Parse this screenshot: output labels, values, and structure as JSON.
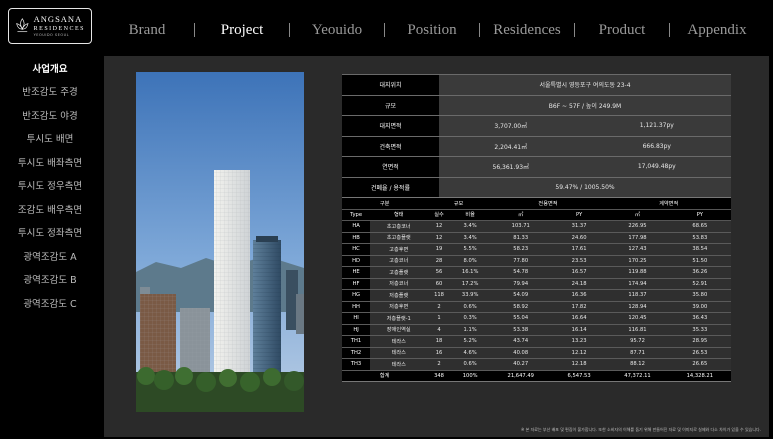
{
  "logo": {
    "main": "ANGSANA",
    "sub": "RESIDENCES",
    "tag": "YEOUIDO SEOUL"
  },
  "nav": {
    "items": [
      "Brand",
      "Project",
      "Yeouido",
      "Position",
      "Residences",
      "Product",
      "Appendix"
    ],
    "active": "Project"
  },
  "sidebar": {
    "items": [
      "사업개요",
      "반조감도 주경",
      "반조감도 야경",
      "투시도 배면",
      "투시도 배좌측면",
      "투시도 정우측면",
      "조감도 배우측면",
      "투시도 정좌측면",
      "광역조감도 A",
      "광역조감도 B",
      "광역조감도 C"
    ],
    "active": "사업개요"
  },
  "info": {
    "rows": [
      {
        "label": "대지위치",
        "values": [
          "서울특별시 영등포구 여의도동 23-4"
        ]
      },
      {
        "label": "규모",
        "values": [
          "B6F ~ 57F / 높이 249.9M"
        ]
      },
      {
        "label": "대지면적",
        "values": [
          "3,707.00㎡",
          "1,121.37py"
        ]
      },
      {
        "label": "건축면적",
        "values": [
          "2,204.41㎡",
          "666.83py"
        ]
      },
      {
        "label": "연면적",
        "values": [
          "56,361.93㎡",
          "17,049.48py"
        ]
      },
      {
        "label": "건폐율 / 용적률",
        "values": [
          "59.47% / 1005.50%"
        ]
      }
    ]
  },
  "units": {
    "header1": [
      "구분",
      "규모",
      "전용면적",
      "계약면적"
    ],
    "header2": [
      "Type",
      "형태",
      "실수",
      "비율",
      "㎡",
      "PY",
      "㎡",
      "PY"
    ],
    "rows": [
      [
        "HA",
        "초고층코너",
        "12",
        "3.4%",
        "103.71",
        "31.37",
        "226.95",
        "68.65"
      ],
      [
        "HB",
        "초고층플랫",
        "12",
        "3.4%",
        "81.33",
        "24.60",
        "177.98",
        "53.83"
      ],
      [
        "HC",
        "고층후면",
        "19",
        "5.5%",
        "58.23",
        "17.61",
        "127.43",
        "38.54"
      ],
      [
        "HD",
        "고층코너",
        "28",
        "8.0%",
        "77.80",
        "23.53",
        "170.25",
        "51.50"
      ],
      [
        "HE",
        "고층플랫",
        "56",
        "16.1%",
        "54.78",
        "16.57",
        "119.88",
        "36.26"
      ],
      [
        "HF",
        "저층코너",
        "60",
        "17.2%",
        "79.94",
        "24.18",
        "174.94",
        "52.91"
      ],
      [
        "HG",
        "저층플랫",
        "118",
        "33.9%",
        "54.09",
        "16.36",
        "118.37",
        "35.80"
      ],
      [
        "HH",
        "저층후면",
        "2",
        "0.6%",
        "58.92",
        "17.82",
        "128.94",
        "39.00"
      ],
      [
        "HI",
        "저층플랫-1",
        "1",
        "0.3%",
        "55.04",
        "16.64",
        "120.45",
        "36.43"
      ],
      [
        "HJ",
        "장애인역실",
        "4",
        "1.1%",
        "53.38",
        "16.14",
        "116.81",
        "35.33"
      ],
      [
        "TH1",
        "테라스",
        "18",
        "5.2%",
        "43.74",
        "13.23",
        "95.72",
        "28.95"
      ],
      [
        "TH2",
        "테라스",
        "16",
        "4.6%",
        "40.08",
        "12.12",
        "87.71",
        "26.53"
      ],
      [
        "TH3",
        "테라스",
        "2",
        "0.6%",
        "40.27",
        "12.18",
        "88.12",
        "26.65"
      ]
    ],
    "total": [
      "합계",
      "348",
      "100%",
      "21,647.49",
      "6,547.53",
      "47,372.11",
      "14,328.21"
    ]
  },
  "disclaimer": "※ 본 자료는 부산 배포 및 편집이 불가합니다. 또한 소비자의 이해를 돕기 위해 만들어진 자료 및 이미지로 실제와 다소 차이가 있을 수 있습니다.",
  "colors": {
    "background": "#000000",
    "panel": "#2a2a2a",
    "nav_inactive": "#9a9a9a",
    "nav_active": "#ffffff"
  }
}
